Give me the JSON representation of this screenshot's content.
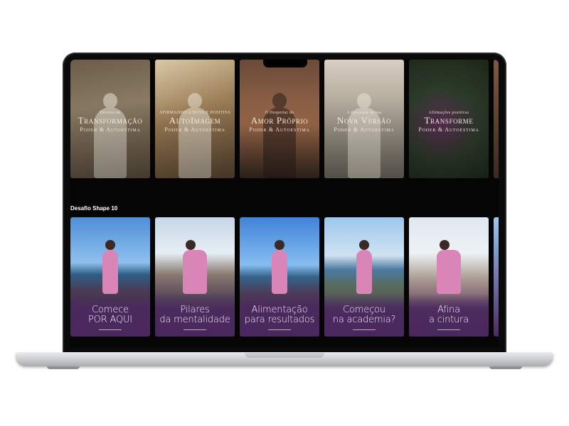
{
  "top_row": [
    {
      "pre": "Decreto de",
      "main": "Transformação",
      "sub": "Poder & Autoestima"
    },
    {
      "pre": "AFIRMANDO A NOVA E POSITIVA",
      "main": "AutoImagem",
      "sub": "Poder & Autoestima"
    },
    {
      "pre": "O Despertar do",
      "main": "Amor Próprio",
      "sub": "Poder & Autoestima"
    },
    {
      "pre": "A Escolada da sua",
      "main": "Nova Versão",
      "sub": "Poder & Autoestima"
    },
    {
      "pre": "Afirmações positivas",
      "main": "Transforme",
      "sub": "Poder & Autoestima"
    }
  ],
  "section": {
    "title": "Desafio Shape 10"
  },
  "bottom_row": [
    {
      "line1": "Comece",
      "line2": "POR AQUI"
    },
    {
      "line1": "Pilares",
      "line2": "da mentalidade"
    },
    {
      "line1": "Alimentação",
      "line2": "para resultados"
    },
    {
      "line1": "Começou",
      "line2": "na academia?"
    },
    {
      "line1": "Afina",
      "line2": "a cintura"
    }
  ]
}
